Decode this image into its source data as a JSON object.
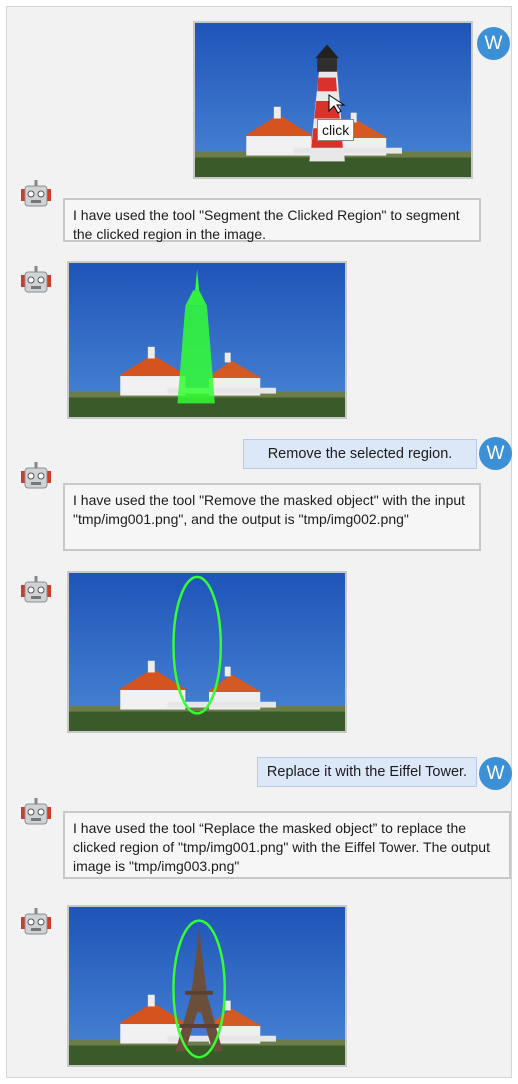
{
  "messages": [
    {
      "role": "user",
      "type": "image",
      "avatar": "W",
      "overlay_label": "click"
    },
    {
      "role": "bot",
      "type": "text",
      "text": "I have used the tool \"Segment the Clicked Region\" to segment the clicked region in the image."
    },
    {
      "role": "bot",
      "type": "image",
      "annotation": "green-mask-lighthouse"
    },
    {
      "role": "user",
      "type": "text",
      "avatar": "W",
      "text": "Remove the selected region."
    },
    {
      "role": "bot",
      "type": "text",
      "text": "I have used the tool \"Remove the masked object\" with the input \"tmp/img001.png\", and the output is \"tmp/img002.png\""
    },
    {
      "role": "bot",
      "type": "image",
      "annotation": "green-ellipse-removed"
    },
    {
      "role": "user",
      "type": "text",
      "avatar": "W",
      "text": "Replace it with the Eiffel Tower."
    },
    {
      "role": "bot",
      "type": "text",
      "text": "I have used the tool “Replace the masked object” to replace the clicked region of \"tmp/img001.png\" with the Eiffel Tower. The output image is \"tmp/img003.png\""
    },
    {
      "role": "bot",
      "type": "image",
      "annotation": "green-ellipse-eiffel"
    }
  ],
  "icons": {
    "bot": "robot-icon",
    "cursor": "cursor-arrow-icon"
  },
  "colors": {
    "user_avatar": "#3d8fd6",
    "user_bubble": "#dce7f7",
    "mask": "#33ff33",
    "sky": "#2b64c4"
  }
}
